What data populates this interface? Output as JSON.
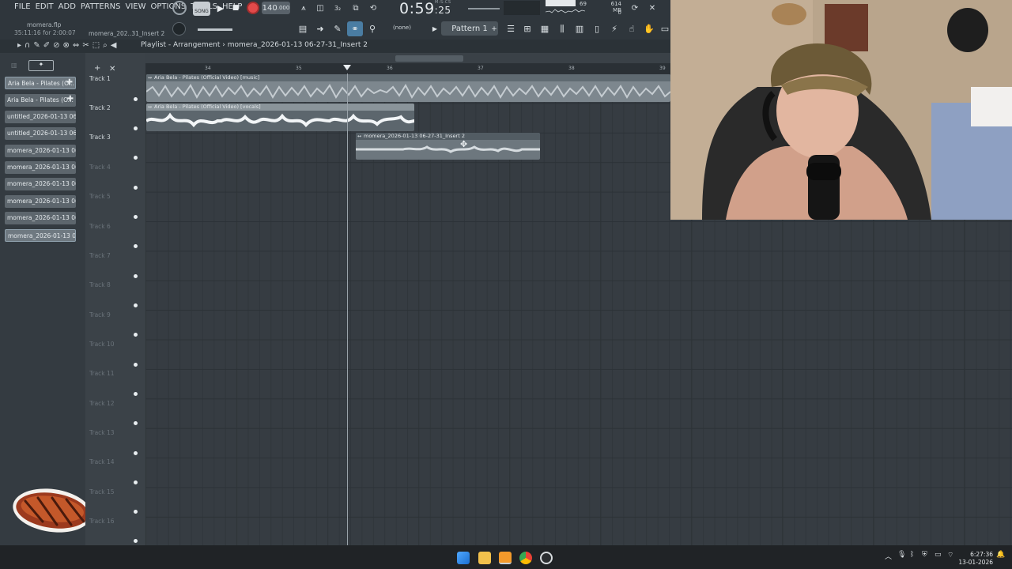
{
  "menu": [
    "FILE",
    "EDIT",
    "ADD",
    "PATTERNS",
    "VIEW",
    "OPTIONS",
    "TOOLS",
    "HELP"
  ],
  "project": {
    "file": "momera.flp",
    "time": "35:11:16 for 2:00:07",
    "insert": "momera_202..31_Insert 2"
  },
  "transport": {
    "song_label": "SONG",
    "tempo": "140",
    "tempo_decimal": ".000",
    "time_main": "0:59",
    "time_sub": ":25",
    "time_unit": "M:S:CS"
  },
  "monitor": {
    "voices": "69",
    "memory": "614 MB",
    "cpu_value": "0"
  },
  "toolbar": {
    "snap": "(none)",
    "pattern": "Pattern 1"
  },
  "playlist": {
    "title": "Playlist - Arrangement",
    "breadcrumb": "momera_2026-01-13 06-27-31_Insert 2"
  },
  "ruler": [
    "34",
    "35",
    "36",
    "37",
    "38",
    "39"
  ],
  "browser": {
    "items": [
      "Aria Bela - Pilates (O...",
      "Aria Bela - Pilates (O...",
      "untitled_2026-01-13 06-...",
      "untitled_2026-01-13 06-...",
      "momera_2026-01-13 06...",
      "momera_2026-01-13 06...",
      "momera_2026-01-13 06...",
      "momera_2026-01-13 06...",
      "momera_2026-01-13 06...",
      "momera_2026-01-13 06..."
    ]
  },
  "tracks": [
    "Track 1",
    "Track 2",
    "Track 3",
    "Track 4",
    "Track 5",
    "Track 6",
    "Track 7",
    "Track 8",
    "Track 9",
    "Track 10",
    "Track 11",
    "Track 12",
    "Track 13",
    "Track 14",
    "Track 15",
    "Track 16"
  ],
  "clips": {
    "music": "Aria Bela - Pilates (Official Video) [music]",
    "vocals": "Aria Bela - Pilates (Official Video) [vocals]",
    "recording": "momera_2026-01-13 06-27-31_Insert 2"
  },
  "taskbar": {
    "time": "6:27:36",
    "date": "13-01-2026"
  },
  "colors": {
    "accent": "#4a7da3",
    "record": "#e24a4a",
    "clip": "#7b858c"
  }
}
